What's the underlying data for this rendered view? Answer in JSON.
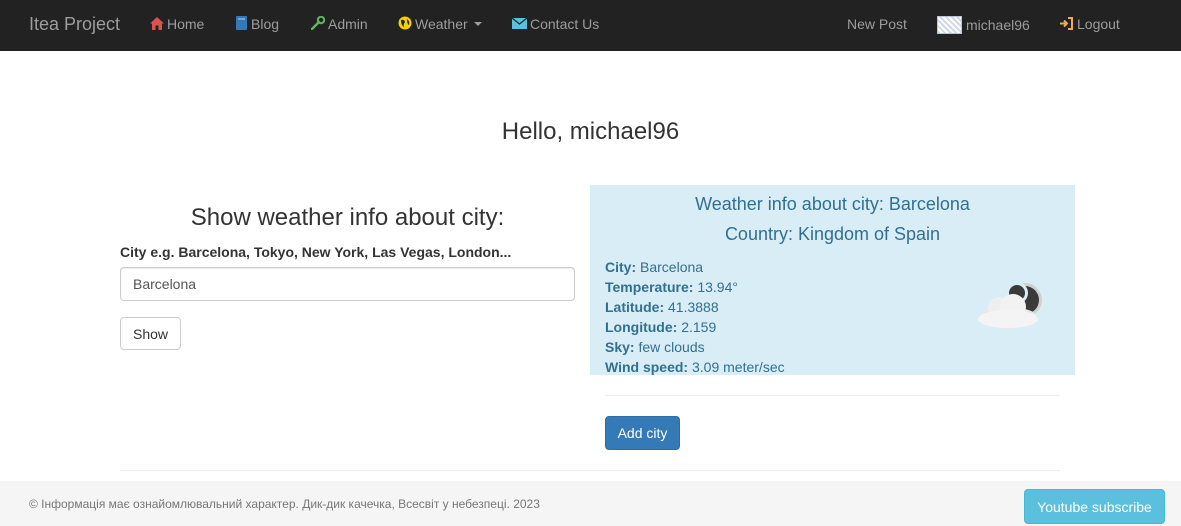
{
  "navbar": {
    "brand": "Itea Project",
    "items": {
      "home": "Home",
      "blog": "Blog",
      "admin": "Admin",
      "weather": "Weather",
      "contact": "Contact Us"
    },
    "right": {
      "new_post": "New Post",
      "username": "michael96",
      "logout": "Logout"
    },
    "icons": {
      "home": "home-icon",
      "blog": "book-icon",
      "admin": "wrench-icon",
      "weather": "globe-icon",
      "contact": "envelope-icon",
      "logout": "logout-icon"
    },
    "colors": {
      "background": "#222222",
      "text": "#9d9d9d",
      "home_icon": "#d9534f",
      "blog_icon": "#337ab7",
      "admin_icon": "#5cb85c",
      "weather_icon": "#f0ad4e",
      "contact_icon": "#5bc0de",
      "logout_icon": "#f0ad4e"
    }
  },
  "main": {
    "greeting": "Hello, michael96",
    "form": {
      "title": "Show weather info about city:",
      "label": "City e.g. Barcelona, Tokyo, New York, Las Vegas, London...",
      "input_value": "Barcelona",
      "submit_label": "Show"
    },
    "weather": {
      "title": "Weather info about city: Barcelona",
      "country": "Country: Kingdom of Spain",
      "rows": [
        {
          "label": "City:",
          "value": "Barcelona"
        },
        {
          "label": "Temperature:",
          "value": "13.94°"
        },
        {
          "label": "Latitude:",
          "value": "41.3888"
        },
        {
          "label": "Longitude:",
          "value": "2.159"
        },
        {
          "label": "Sky:",
          "value": "few clouds"
        },
        {
          "label": "Wind speed:",
          "value": "3.09 meter/sec"
        }
      ],
      "icon": "few-clouds-night-icon",
      "colors": {
        "panel_bg": "#d9edf7",
        "panel_text": "#31708f"
      }
    },
    "add_city_label": "Add city"
  },
  "footer": {
    "text": "© Інформація має ознайомлювальний характер. Дик-дик качечка, Всесвіт у небезпеці. 2023",
    "youtube_label": "Youtube subscribe"
  }
}
